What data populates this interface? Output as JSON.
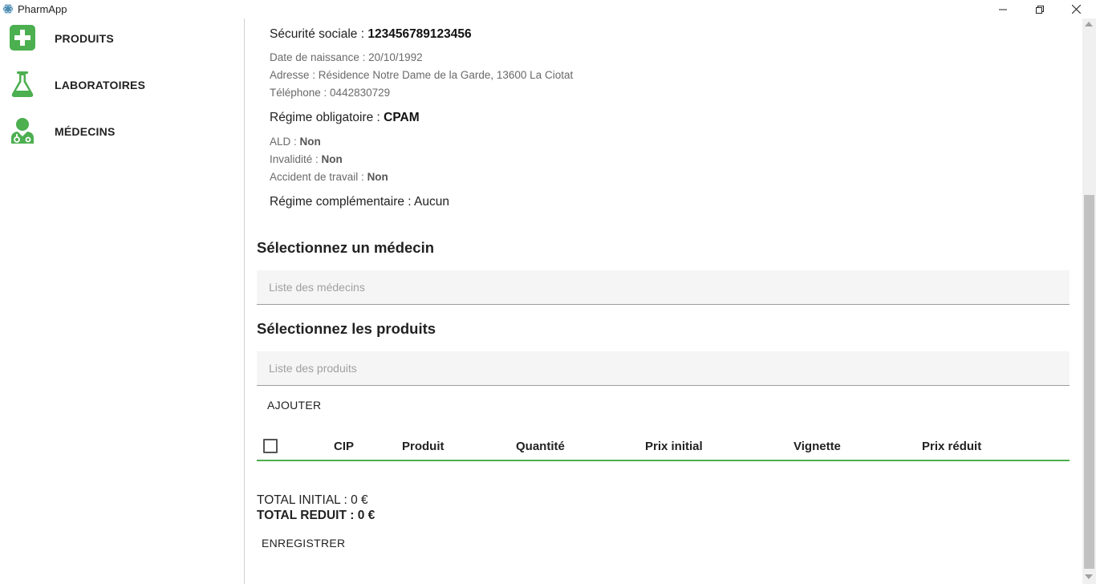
{
  "window": {
    "title": "PharmApp",
    "icon": "atom-icon"
  },
  "sidebar": {
    "accent_color": "#4caf50",
    "items": [
      {
        "label": "PRODUITS",
        "icon": "plus-icon"
      },
      {
        "label": "LABORATOIRES",
        "icon": "flask-icon"
      },
      {
        "label": "MÉDECINS",
        "icon": "doctor-icon"
      }
    ]
  },
  "patient": {
    "secu_label": "Sécurité sociale : ",
    "secu_value": "123456789123456",
    "birth_date": "Date de naissance : 20/10/1992",
    "address": "Adresse : Résidence Notre Dame de la Garde, 13600 La Ciotat",
    "phone": "Téléphone : 0442830729",
    "regime_label": "Régime obligatoire : ",
    "regime_value": "CPAM",
    "ald_label": "ALD : ",
    "ald_value": "Non",
    "invalidite_label": "Invalidité : ",
    "invalidite_value": "Non",
    "accident_label": "Accident de travail : ",
    "accident_value": "Non",
    "complementaire": "Régime complémentaire : Aucun"
  },
  "medecin": {
    "title": "Sélectionnez un médecin",
    "placeholder": "Liste des médecins"
  },
  "produits": {
    "title": "Sélectionnez les produits",
    "placeholder": "Liste des produits",
    "add_button": "AJOUTER"
  },
  "table": {
    "columns": [
      "CIP",
      "Produit",
      "Quantité",
      "Prix initial",
      "Vignette",
      "Prix réduit"
    ],
    "rows": []
  },
  "totals": {
    "initial": "TOTAL INITIAL : 0 €",
    "reduit": "TOTAL REDUIT : 0 €"
  },
  "save_button": "ENREGISTRER"
}
